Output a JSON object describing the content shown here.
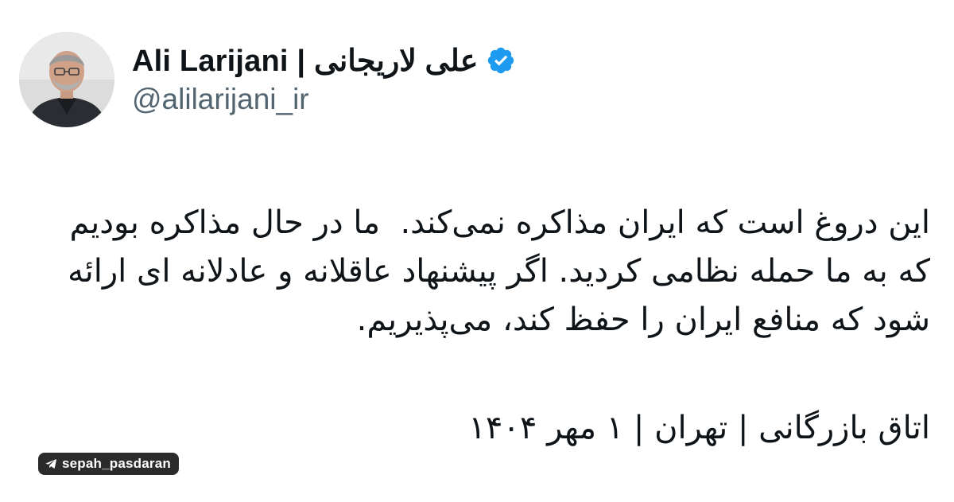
{
  "author": {
    "display_name": "Ali Larijani | علی لاریجانی",
    "handle": "@alilarijani_ir",
    "verified_icon": "verified-badge-icon",
    "avatar_icon": "profile-photo"
  },
  "tweet": {
    "text": "این دروغ است که ایران مذاکره نمی‌کند.  ما در حال مذاکره بودیم که به ما حمله نظامی کردید. اگر پیشنهاد عاقلانه و عادلانه ای ارائه شود که منافع ایران را حفظ کند، می‌پذیریم.",
    "signature": "اتاق بازرگانی | تهران | ۱ مهر ۱۴۰۴"
  },
  "watermark": {
    "label": "sepah_pasdaran",
    "icon": "telegram-icon"
  },
  "colors": {
    "verified": "#1d9bf0",
    "text": "#0f1419",
    "secondary": "#536471",
    "watermark_bg": "#2b2b2b"
  }
}
